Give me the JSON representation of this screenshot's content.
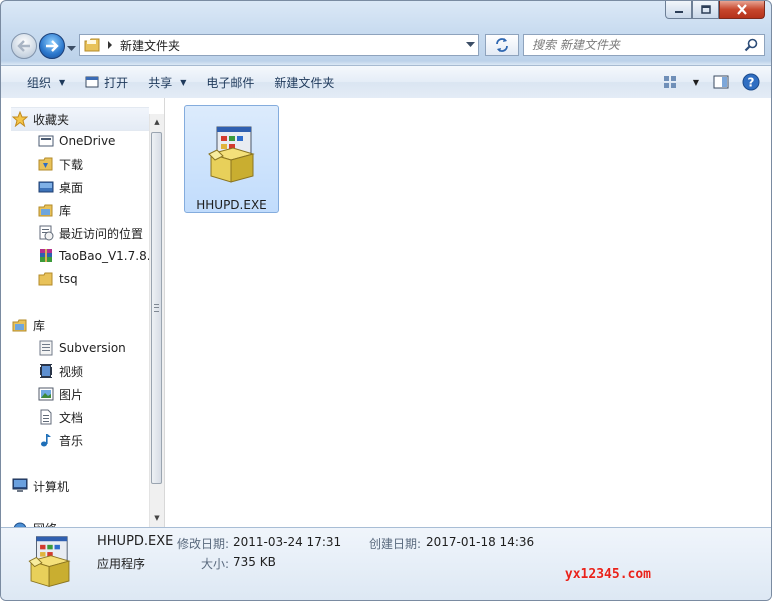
{
  "window": {
    "address": {
      "folder_name": "新建文件夹"
    },
    "search": {
      "placeholder": "搜索 新建文件夹"
    }
  },
  "toolbar": {
    "organize": "组织",
    "open": "打开",
    "share": "共享",
    "email": "电子邮件",
    "new_folder": "新建文件夹"
  },
  "sidebar": {
    "favorites": {
      "label": "收藏夹",
      "items": [
        {
          "label": "OneDrive",
          "icon": "onedrive-icon"
        },
        {
          "label": "下载",
          "icon": "downloads-folder-icon"
        },
        {
          "label": "桌面",
          "icon": "desktop-icon"
        },
        {
          "label": "库",
          "icon": "library-icon"
        },
        {
          "label": "最近访问的位置",
          "icon": "recent-places-icon"
        },
        {
          "label": "TaoBao_V1.7.8.",
          "icon": "winrar-archive-icon"
        },
        {
          "label": "tsq",
          "icon": "folder-icon"
        }
      ]
    },
    "libraries": {
      "label": "库",
      "items": [
        {
          "label": "Subversion",
          "icon": "subversion-library-icon"
        },
        {
          "label": "视频",
          "icon": "video-library-icon"
        },
        {
          "label": "图片",
          "icon": "pictures-library-icon"
        },
        {
          "label": "文档",
          "icon": "documents-library-icon"
        },
        {
          "label": "音乐",
          "icon": "music-library-icon"
        }
      ]
    },
    "computer": {
      "label": "计算机"
    },
    "network": {
      "label": "网络"
    }
  },
  "content": {
    "files": [
      {
        "name": "HHUPD.EXE",
        "selected": true
      }
    ]
  },
  "details": {
    "name": "HHUPD.EXE",
    "type": "应用程序",
    "modified_label": "修改日期:",
    "modified_value": "2011-03-24 17:31",
    "size_label": "大小:",
    "size_value": "735 KB",
    "created_label": "创建日期:",
    "created_value": "2017-01-18 14:36"
  },
  "watermark": "yx12345.com",
  "colors": {
    "selection": "#cce4fc",
    "link_text": "#1e395b",
    "watermark": "#e8221b"
  }
}
